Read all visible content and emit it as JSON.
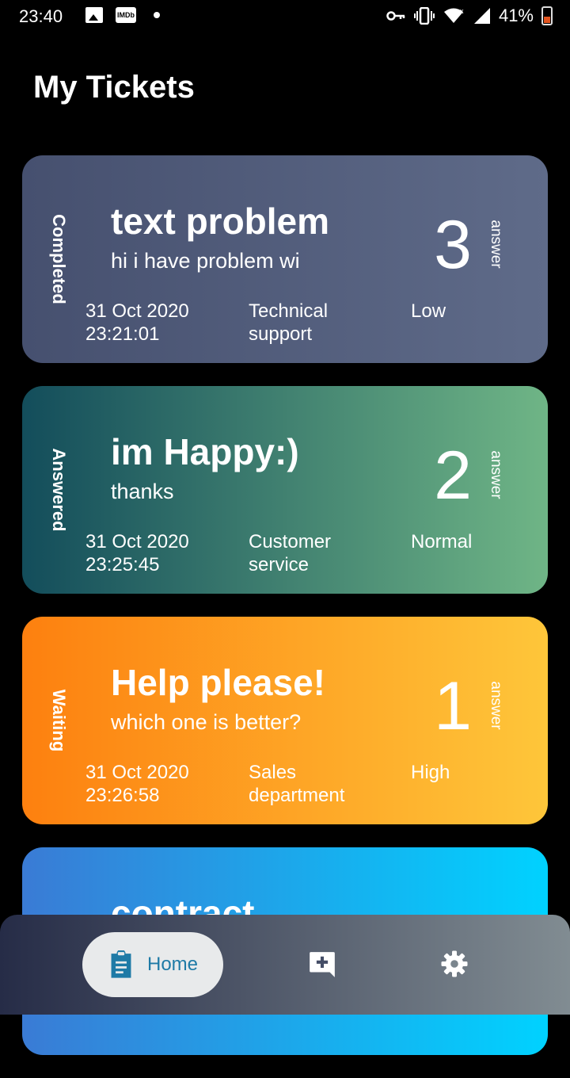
{
  "status_bar": {
    "time": "23:40",
    "imdb_label": "IMDb",
    "battery": "41%",
    "icons": [
      "image-icon",
      "imdb-icon",
      "dot-icon",
      "key-icon",
      "vibrate-icon",
      "wifi-icon",
      "signal-icon",
      "battery-icon"
    ]
  },
  "header": {
    "title": "My Tickets"
  },
  "tickets": [
    {
      "status": "Completed",
      "title": "text problem",
      "subtitle": "hi i have problem wi",
      "count": "3",
      "count_label": "answer",
      "date": "31 Oct 2020",
      "time": "23:21:01",
      "dept_line1": "Technical",
      "dept_line2": "support",
      "priority": "Low",
      "colors": [
        "#46506f",
        "#5f6b89"
      ]
    },
    {
      "status": "Answered",
      "title": "im Happy:)",
      "subtitle": "thanks",
      "count": "2",
      "count_label": "answer",
      "date": "31 Oct 2020",
      "time": "23:25:45",
      "dept_line1": "Customer",
      "dept_line2": "service",
      "priority": "Normal",
      "colors": [
        "#134d5b",
        "#6fb586"
      ]
    },
    {
      "status": "Waiting",
      "title": "Help please!",
      "subtitle": "which one is better?",
      "count": "1",
      "count_label": "answer",
      "date": "31 Oct 2020",
      "time": "23:26:58",
      "dept_line1": "Sales",
      "dept_line2": "department",
      "priority": "High",
      "colors": [
        "#fd800f",
        "#fec63a"
      ]
    },
    {
      "title": "contract",
      "colors": [
        "#3a7bd5",
        "#00d2ff"
      ]
    }
  ],
  "bottom_nav": {
    "home_label": "Home",
    "items": [
      "clipboard-icon",
      "add-comment-icon",
      "gear-icon"
    ],
    "active_color": "#1e7aa6"
  }
}
